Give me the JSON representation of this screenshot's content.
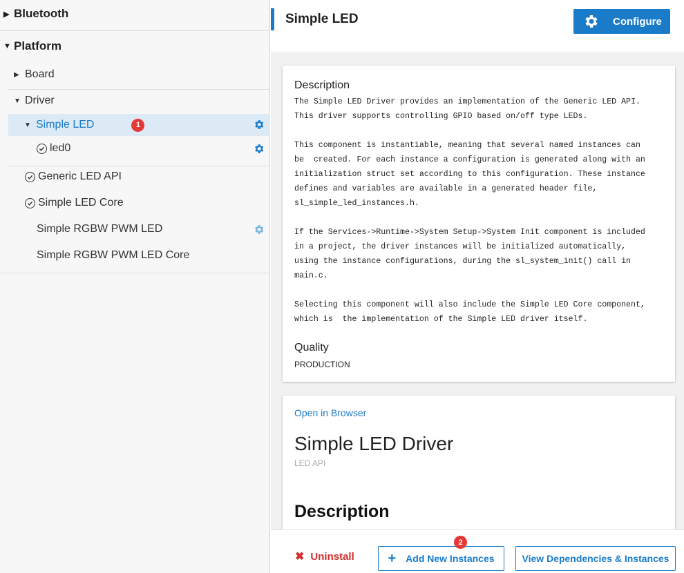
{
  "sidebar": {
    "bluetooth": "Bluetooth",
    "platform": "Platform",
    "board": "Board",
    "driver": "Driver",
    "simple_led": "Simple LED",
    "simple_led_badge": "1",
    "led0": "led0",
    "generic_led_api": "Generic LED API",
    "simple_led_core": "Simple LED Core",
    "simple_rgbw_pwm_led": "Simple RGBW PWM LED",
    "simple_rgbw_pwm_led_core": "Simple RGBW PWM LED Core"
  },
  "header": {
    "title": "Simple LED",
    "configure_label": "Configure"
  },
  "details": {
    "description_heading": "Description",
    "description_text": "The Simple LED Driver provides an implementation of the Generic LED API.\nThis driver supports controlling GPIO based on/off type LEDs.\n\nThis component is instantiable, meaning that several named instances can\nbe  created. For each instance a configuration is generated along with an\ninitialization struct set according to this configuration. These instance\ndefines and variables are available in a generated header file,\nsl_simple_led_instances.h.\n\nIf the Services->Runtime->System Setup->System Init component is included\nin a project, the driver instances will be initialized automatically,\nusing the instance configurations, during the sl_system_init() call in\nmain.c.\n\nSelecting this component will also include the Simple LED Core component,\nwhich is  the implementation of the Simple LED driver itself.",
    "quality_heading": "Quality",
    "quality_value": "PRODUCTION"
  },
  "doc": {
    "open_in_browser": "Open in Browser",
    "title": "Simple LED Driver",
    "subtitle": "LED API",
    "description_heading": "Description"
  },
  "footer": {
    "uninstall_label": "Uninstall",
    "add_label": "Add New Instances",
    "add_badge": "2",
    "view_label": "View Dependencies & Instances"
  },
  "colors": {
    "accent": "#1a7bc8",
    "danger": "#d32f2f",
    "badge": "#e53935",
    "selected_bg": "#dbeaf4"
  }
}
